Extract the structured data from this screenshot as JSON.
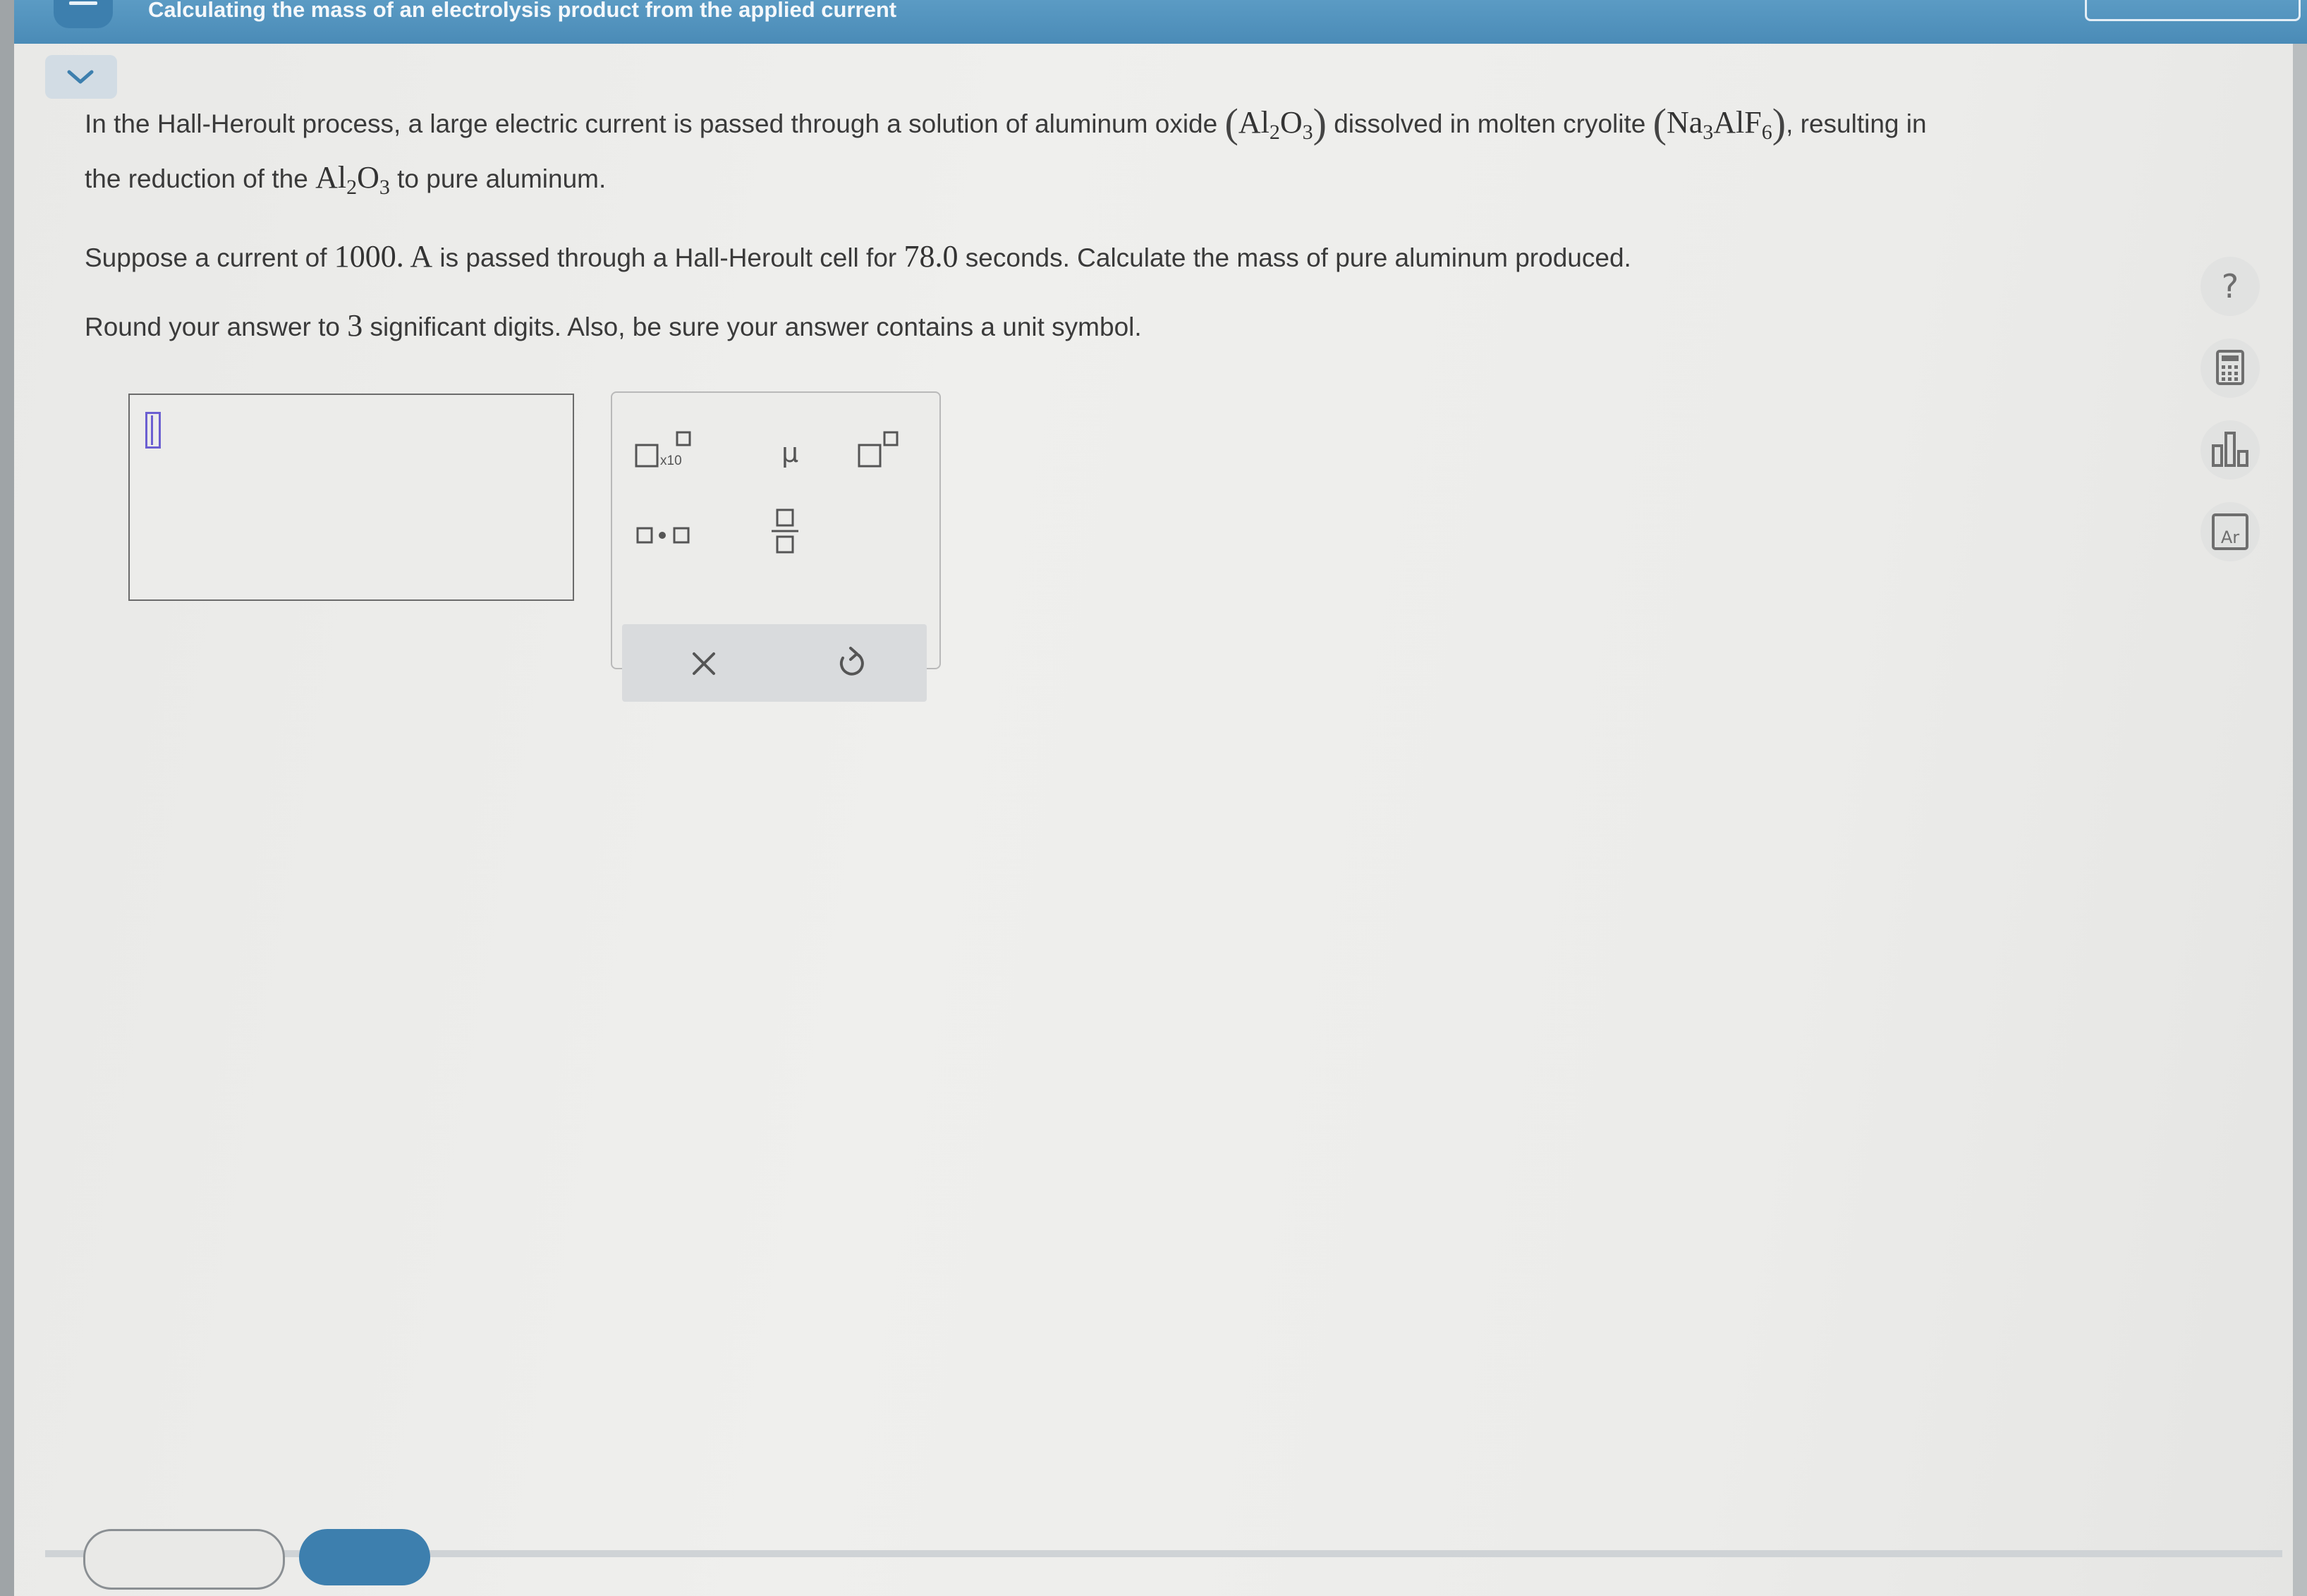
{
  "header": {
    "title": "Calculating the mass of an electrolysis product from the applied current"
  },
  "problem": {
    "line1": {
      "t1": "In the Hall-Heroult process, a large electric current is passed through a solution of aluminum oxide ",
      "al": "Al",
      "s2": "2",
      "o": "O",
      "s3": "3",
      "t2": " dissolved in molten cryolite ",
      "na": "Na",
      "s3b": "3",
      "alf": "AlF",
      "s6": "6",
      "t3": ", resulting in"
    },
    "line2": {
      "t1": "the reduction of the ",
      "al": "Al",
      "s2": "2",
      "o": "O",
      "s3": "3",
      "t2": " to pure aluminum."
    },
    "line3": {
      "t1": "Suppose a current of ",
      "current": "1000. A",
      "t2": " is passed through a Hall-Heroult cell for ",
      "time": "78.0",
      "t3": " seconds. Calculate the mass of pure aluminum produced."
    },
    "line4": {
      "t1": "Round your answer to ",
      "digits": "3",
      "t2": " significant digits. Also, be sure your answer contains a unit symbol."
    }
  },
  "answer": {
    "value": ""
  },
  "palette": {
    "sci_notation_label": "x10",
    "mu_label": "μ",
    "buttons": [
      "sci-notation",
      "micro",
      "superscript",
      "multiply-dot",
      "fraction",
      "clear",
      "undo"
    ]
  },
  "side_tools": [
    {
      "name": "help",
      "glyph": "?"
    },
    {
      "name": "calculator",
      "glyph": "calculator-icon"
    },
    {
      "name": "data",
      "glyph": "bar-chart-icon"
    },
    {
      "name": "periodic-table",
      "glyph": "Ar"
    }
  ],
  "colors": {
    "header": "#4a8bb7",
    "cursor": "#6b5fd1",
    "bottom_button": "#3d7fae"
  }
}
